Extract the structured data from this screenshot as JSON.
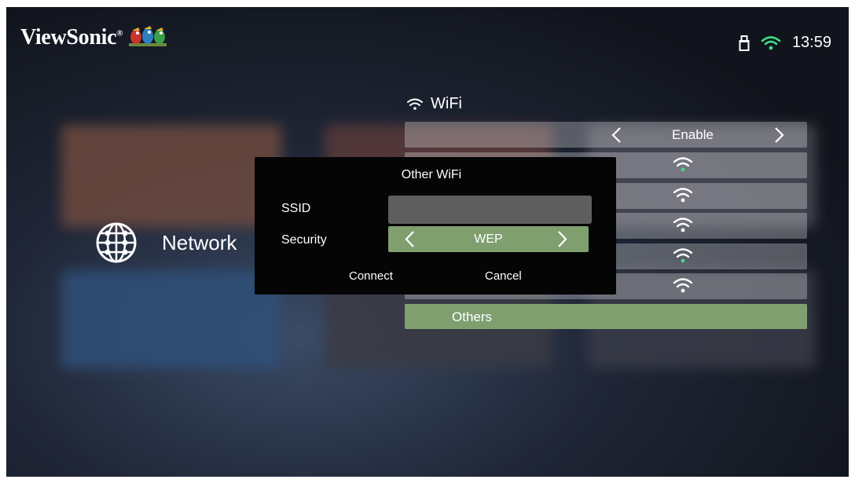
{
  "header": {
    "brand": "ViewSonic",
    "brand_mark": "®",
    "logo_icon": "birds-logo-icon",
    "status_icons": [
      "usb-storage-icon",
      "wifi-icon"
    ],
    "time": "13:59"
  },
  "sidebar": {
    "icon": "globe-network-icon",
    "label": "Network"
  },
  "wifi_panel": {
    "header_label": "WiFi",
    "header_icon": "wifi-icon",
    "enable_value": "Enable",
    "network_rows": 5,
    "others_label": "Others"
  },
  "dialog": {
    "title": "Other WiFi",
    "ssid_label": "SSID",
    "ssid_value": "",
    "security_label": "Security",
    "security_value": "WEP",
    "connect_label": "Connect",
    "cancel_label": "Cancel"
  },
  "colors": {
    "accent_green": "#7f9f6f",
    "dialog_bg": "#050505",
    "input_gray": "#5e5e5e"
  }
}
